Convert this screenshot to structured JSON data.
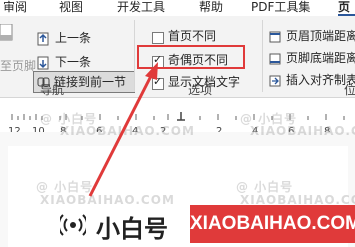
{
  "tabs": [
    {
      "label": "审阅"
    },
    {
      "label": "视图"
    },
    {
      "label": "开发工具"
    },
    {
      "label": "帮助"
    },
    {
      "label": "PDF工具集"
    },
    {
      "label": "页"
    }
  ],
  "ribbon": {
    "nav_partial": "至页脚",
    "prev_label": "上一条",
    "next_label": "下一条",
    "link_prev_label": "链接到前一节",
    "group_nav_label": "导航",
    "options": [
      {
        "label": "首页不同",
        "checked": false
      },
      {
        "label": "奇偶页不同",
        "checked": true
      },
      {
        "label": "显示文档文字",
        "checked": true
      }
    ],
    "group_options_label": "选项",
    "pos_items": [
      {
        "label": "页眉顶端距离"
      },
      {
        "label": "页脚底端距离"
      },
      {
        "label": "插入对齐制表"
      }
    ],
    "group_pos_label": "位"
  },
  "ruler": {
    "numbers": [
      "12",
      "10",
      "8",
      "6",
      "4",
      "2",
      "2",
      "4",
      "6",
      "8"
    ]
  },
  "watermark": {
    "text1": "@ 小白号",
    "text2": "XIAOBAIHAO.COM"
  },
  "brand": {
    "cn": "小白号",
    "en": "XIAOBAIHAO.COM",
    "accent": "#e03a3a"
  }
}
